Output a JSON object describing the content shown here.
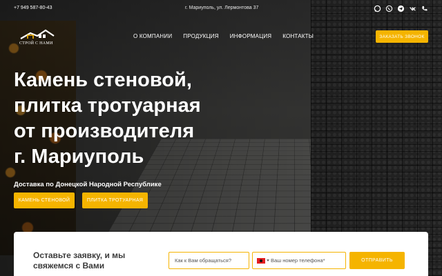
{
  "topbar": {
    "phone": "+7 949 587-80-43",
    "address": "г. Мариуполь, ул. Лермонтова 37",
    "socials": [
      "chat-icon",
      "whatsapp-icon",
      "telegram-icon",
      "vk-icon",
      "phone-icon"
    ]
  },
  "logo": {
    "text": "СТРОЙ С НАМИ"
  },
  "nav": {
    "items": [
      "О КОМПАНИИ",
      "ПРОДУКЦИЯ",
      "ИНФОРМАЦИЯ",
      "КОНТАКТЫ"
    ],
    "call_button": "ЗАКАЗАТЬ ЗВОНОК"
  },
  "hero": {
    "title_lines": [
      "Камень стеновой,",
      "плитка тротуарная",
      "от производителя",
      "г. Мариуполь"
    ],
    "subtitle": "Доставка по Донецкой Народной Республике",
    "cta_stone": "КАМЕНЬ СТЕНОВОЙ",
    "cta_tile": "ПЛИТКА ТРОТУАРНАЯ"
  },
  "form": {
    "title": "Оставьте заявку, и мы свяжемся с Вами",
    "name_placeholder": "Как к Вам обращаться?",
    "phone_placeholder": "Ваш номер телефона*",
    "submit": "ОТПРАВИТЬ"
  },
  "colors": {
    "accent": "#f5b400",
    "text_dark": "#3a3a3a"
  }
}
